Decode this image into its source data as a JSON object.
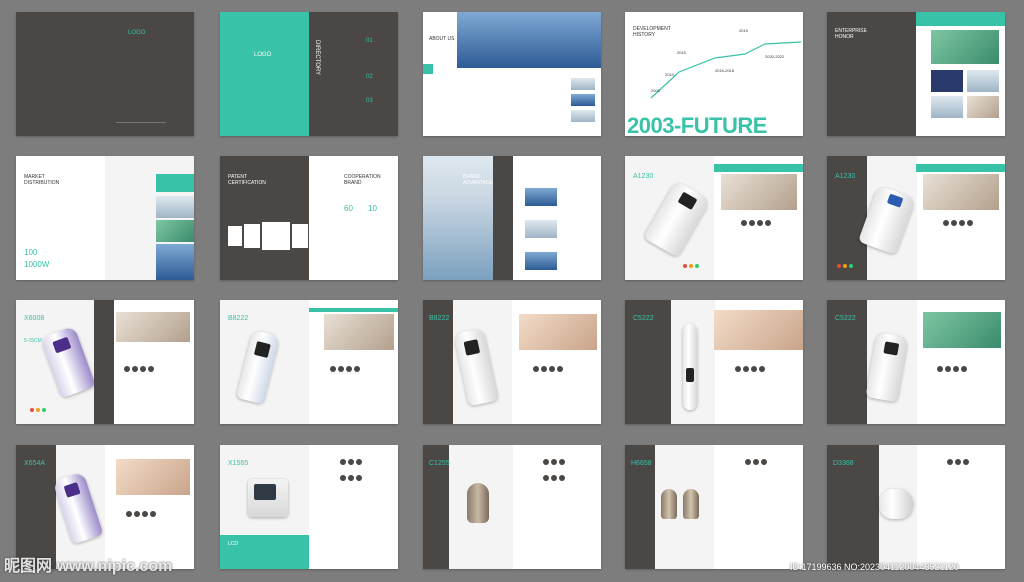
{
  "colors": {
    "accent": "#38c2a8",
    "dark": "#4a4745",
    "background": "#7d7d7d"
  },
  "row1": {
    "logo": "LOGO",
    "logo2": "LOGO",
    "directory": "DIRECTORY",
    "dir_nums": [
      "01",
      "02",
      "03"
    ],
    "about": "ABOUT US",
    "dev_history": [
      "DEVELOPMENT",
      "HISTORY"
    ],
    "years": [
      "2019",
      "2015",
      "2016-2018",
      "2010",
      "2003",
      "2020-2022"
    ],
    "future": "2003-FUTURE",
    "honor": [
      "ENTERPRISE",
      "HONOR"
    ]
  },
  "row2": {
    "market": [
      "MARKET",
      "DISTRIBUTION"
    ],
    "market_stats": [
      "100",
      "1000W"
    ],
    "patent": [
      "PATENT",
      "CERTIFICATION"
    ],
    "coop": [
      "COOPERATION",
      "BRAND"
    ],
    "coop_stats": [
      "60",
      "10"
    ],
    "brand": [
      "BRAND",
      "ADVANTAGE"
    ],
    "a1230a": "A1230",
    "a1230b": "A1230"
  },
  "row3": {
    "x6a": "X6008",
    "x6a_sub": "5-15CM",
    "b8222a": "B8222",
    "b8222b": "B8222",
    "c5222a": "C5222",
    "c5222b": "C5222"
  },
  "row4": {
    "x654a": "X654A",
    "x1565": "X1565",
    "x1565_sub": "LCD",
    "c1255": "C1255",
    "h6658": "H6658",
    "d3368": "D3368"
  },
  "watermark": {
    "site": "昵图网 www.nipic.com",
    "id": "ID:17199636 NO:20230411200443521120"
  }
}
